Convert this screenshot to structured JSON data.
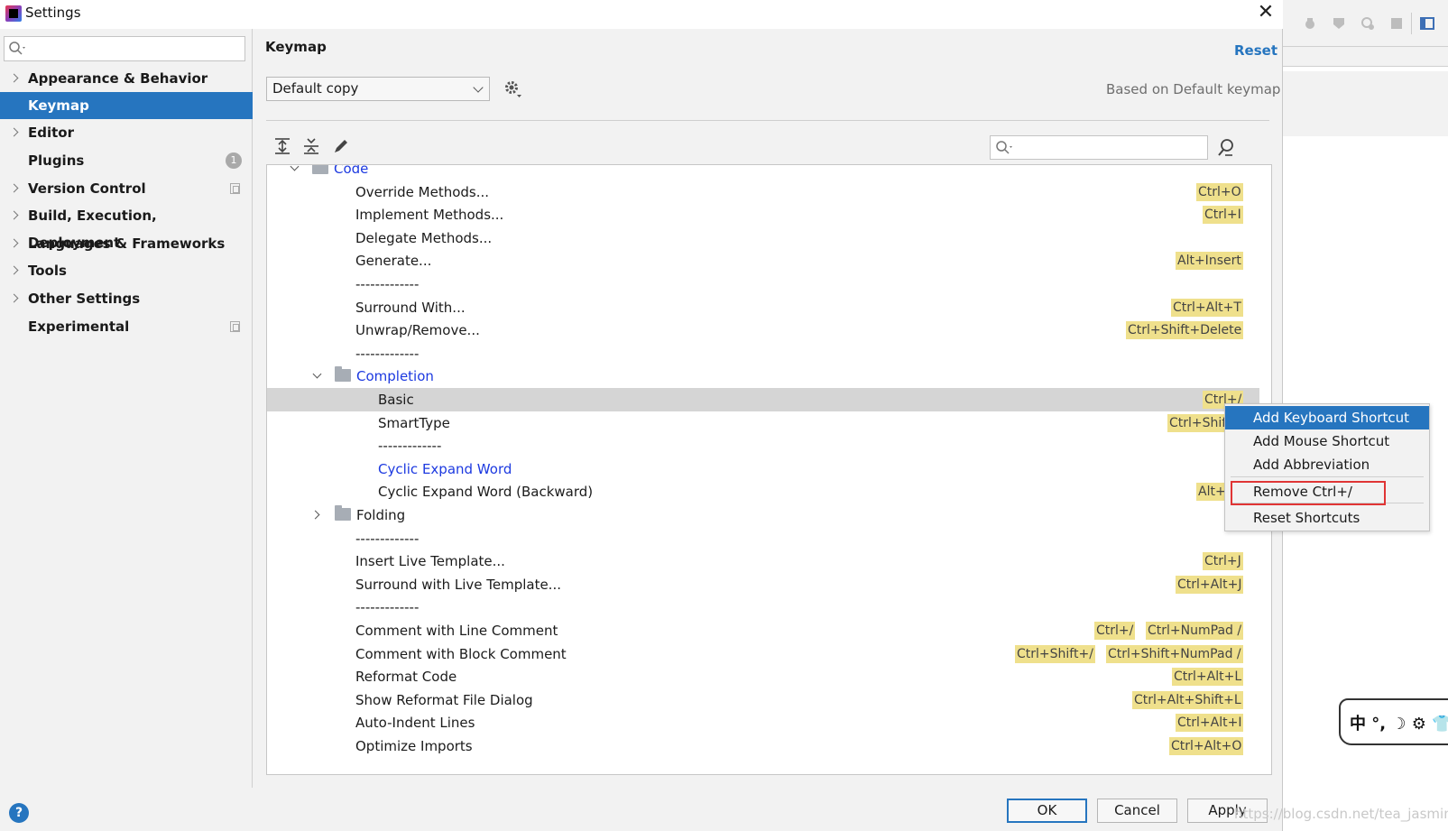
{
  "window": {
    "title": "Settings",
    "close_glyph": "✕"
  },
  "sidebar": {
    "search_placeholder": "",
    "items": [
      {
        "label": "Appearance & Behavior",
        "expandable": true
      },
      {
        "label": "Keymap",
        "selected": true
      },
      {
        "label": "Editor",
        "expandable": true
      },
      {
        "label": "Plugins",
        "badge": "1"
      },
      {
        "label": "Version Control",
        "expandable": true,
        "icon": "copy-icon"
      },
      {
        "label": "Build, Execution, Deployment",
        "expandable": true
      },
      {
        "label": "Languages & Frameworks",
        "expandable": true
      },
      {
        "label": "Tools",
        "expandable": true
      },
      {
        "label": "Other Settings",
        "expandable": true
      },
      {
        "label": "Experimental",
        "icon": "copy-icon"
      }
    ]
  },
  "main": {
    "title": "Keymap",
    "reset_label": "Reset",
    "keymap_value": "Default copy",
    "based_on": "Based on Default keymap",
    "filter_placeholder": ""
  },
  "tree": {
    "rows": [
      {
        "label": "Code",
        "type": "folder",
        "expanded": true,
        "level": 0,
        "blue": true
      },
      {
        "label": "Override Methods...",
        "level": 2,
        "shortcuts": [
          "Ctrl+O"
        ]
      },
      {
        "label": "Implement Methods...",
        "level": 2,
        "shortcuts": [
          "Ctrl+I"
        ]
      },
      {
        "label": "Delegate Methods...",
        "level": 2,
        "shortcuts": []
      },
      {
        "label": "Generate...",
        "level": 2,
        "shortcuts": [
          "Alt+Insert"
        ]
      },
      {
        "label": "-------------",
        "level": 2,
        "shortcuts": []
      },
      {
        "label": "Surround With...",
        "level": 2,
        "shortcuts": [
          "Ctrl+Alt+T"
        ]
      },
      {
        "label": "Unwrap/Remove...",
        "level": 2,
        "shortcuts": [
          "Ctrl+Shift+Delete"
        ]
      },
      {
        "label": "-------------",
        "level": 2,
        "shortcuts": []
      },
      {
        "label": "Completion",
        "type": "folder",
        "expanded": true,
        "level": 1,
        "blue": true
      },
      {
        "label": "Basic",
        "level": 3,
        "shortcuts": [
          "Ctrl+/"
        ],
        "selected": true
      },
      {
        "label": "SmartType",
        "level": 3,
        "shortcuts": [
          "Ctrl+Shift+"
        ]
      },
      {
        "label": "-------------",
        "level": 3,
        "shortcuts": []
      },
      {
        "label": "Cyclic Expand Word",
        "level": 3,
        "shortcuts": [],
        "blue": true
      },
      {
        "label": "Cyclic Expand Word (Backward)",
        "level": 3,
        "shortcuts": [
          "Alt+Sh"
        ]
      },
      {
        "label": "Folding",
        "type": "folder",
        "expanded": false,
        "level": 1
      },
      {
        "label": "-------------",
        "level": 2,
        "shortcuts": []
      },
      {
        "label": "Insert Live Template...",
        "level": 2,
        "shortcuts": [
          "Ctrl+J"
        ]
      },
      {
        "label": "Surround with Live Template...",
        "level": 2,
        "shortcuts": [
          "Ctrl+Alt+J"
        ]
      },
      {
        "label": "-------------",
        "level": 2,
        "shortcuts": []
      },
      {
        "label": "Comment with Line Comment",
        "level": 2,
        "shortcuts": [
          "Ctrl+/",
          "Ctrl+NumPad /"
        ]
      },
      {
        "label": "Comment with Block Comment",
        "level": 2,
        "shortcuts": [
          "Ctrl+Shift+/",
          "Ctrl+Shift+NumPad /"
        ]
      },
      {
        "label": "Reformat Code",
        "level": 2,
        "shortcuts": [
          "Ctrl+Alt+L"
        ]
      },
      {
        "label": "Show Reformat File Dialog",
        "level": 2,
        "shortcuts": [
          "Ctrl+Alt+Shift+L"
        ]
      },
      {
        "label": "Auto-Indent Lines",
        "level": 2,
        "shortcuts": [
          "Ctrl+Alt+I"
        ]
      },
      {
        "label": "Optimize Imports",
        "level": 2,
        "shortcuts": [
          "Ctrl+Alt+O"
        ]
      }
    ]
  },
  "context_menu": {
    "items": [
      {
        "label": "Add Keyboard Shortcut",
        "highlighted": true
      },
      {
        "label": "Add Mouse Shortcut"
      },
      {
        "label": "Add Abbreviation"
      },
      {
        "label": "Remove Ctrl+/",
        "boxed": true
      },
      {
        "label": "Reset Shortcuts"
      }
    ]
  },
  "buttons": {
    "ok": "OK",
    "cancel": "Cancel",
    "apply": "Apply"
  },
  "help_glyph": "?",
  "background": {
    "ime_text": "中 °, ☽ ⚙ 👕",
    "watermark": "https://blog.csdn.net/tea_jasmine"
  },
  "colors": {
    "accent": "#2675bf",
    "shortcut_bg": "#efe08c",
    "link_blue": "#1c39e0",
    "highlight_red": "#e03535"
  }
}
